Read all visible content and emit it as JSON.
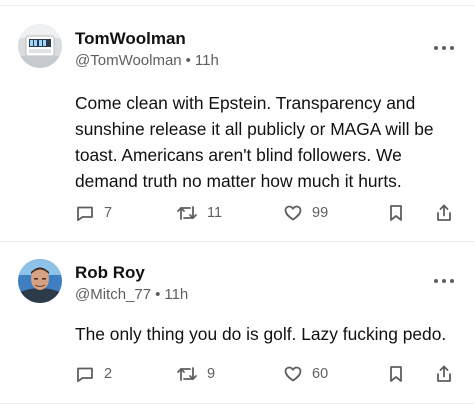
{
  "posts": [
    {
      "author_name": "TomWoolman",
      "handle": "@TomWoolman",
      "separator": "•",
      "time": "11h",
      "text": "Come clean with Epstein. Transparency and sunshine release it all publicly or MAGA will be toast. Americans aren't blind followers. We demand truth no matter how much it hurts.",
      "replies": "7",
      "reposts": "11",
      "likes": "99",
      "avatar_icon": "desk-clock-photo-avatar"
    },
    {
      "author_name": "Rob Roy",
      "handle": "@Mitch_77",
      "separator": "•",
      "time": "11h",
      "text": "The only thing you do is golf. Lazy fucking pedo.",
      "replies": "2",
      "reposts": "9",
      "likes": "60",
      "avatar_icon": "man-portrait-avatar"
    }
  ],
  "icons": {
    "reply": "speech-bubble-icon",
    "repost": "repost-arrows-icon",
    "like": "heart-icon",
    "save": "bookmark-icon",
    "share": "share-upload-icon",
    "more": "more-dots-icon"
  },
  "colors": {
    "text": "#111111",
    "muted": "#5f5f5f",
    "divider": "#ececec"
  }
}
